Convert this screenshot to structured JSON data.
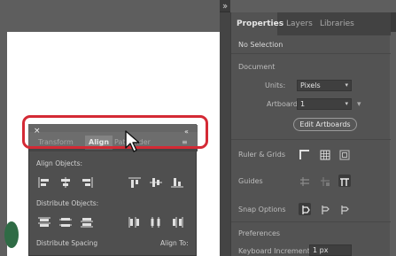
{
  "properties_panel": {
    "tabs": [
      "Properties",
      "Layers",
      "Libraries"
    ],
    "selection": "No Selection",
    "document_section": "Document",
    "units_label": "Units:",
    "units_value": "Pixels",
    "artboard_label": "Artboard:",
    "artboard_value": "1",
    "edit_artboards_button": "Edit Artboards",
    "rulers_grids_label": "Ruler & Grids",
    "guides_label": "Guides",
    "snap_options_label": "Snap Options",
    "preferences_label": "Preferences",
    "keyboard_increment_label": "Keyboard Increment:",
    "keyboard_increment_value": "1 px"
  },
  "align_panel": {
    "close_glyph": "×",
    "collapse_glyph": "«",
    "tabs": [
      "Transform",
      "Align",
      "Pathfinder"
    ],
    "align_objects_label": "Align Objects:",
    "distribute_objects_label": "Distribute Objects:",
    "distribute_spacing_label": "Distribute Spacing",
    "align_to_label": "Align To:"
  },
  "colors": {
    "highlight": "#d42a35",
    "canvas": "#5e5e5e",
    "panel": "#535353"
  }
}
